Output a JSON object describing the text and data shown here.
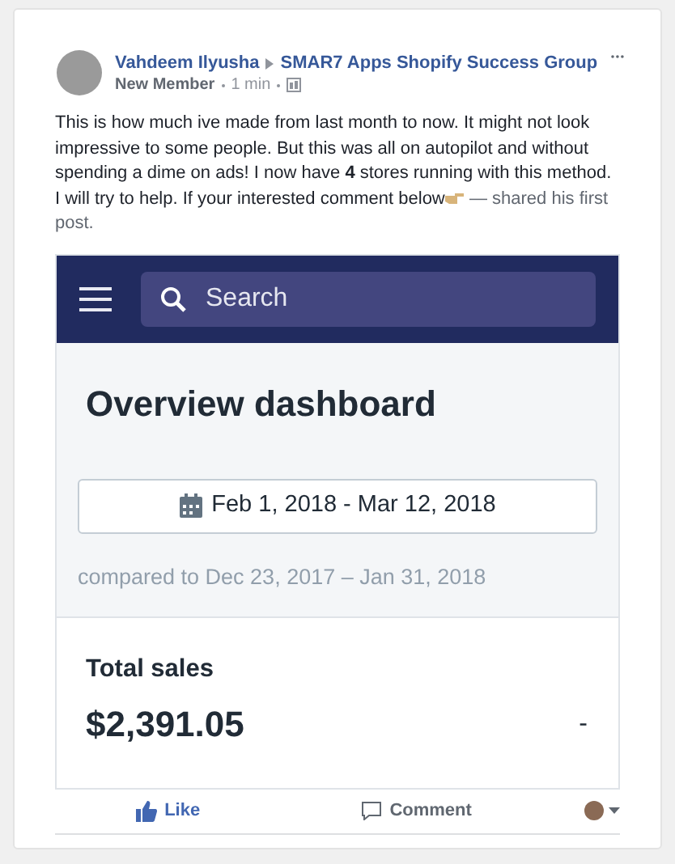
{
  "post": {
    "author": "Vahdeem Ilyusha",
    "group": "SMAR7 Apps Shopify Success Group",
    "role": "New Member",
    "time": "1 min",
    "body": "This is how much ive made from last month to now. It might not look impressive to some people. But this was all on autopilot and without spending a dime on ads! I now have **4** stores running with this method. I will try to help. If your interested comment below",
    "shared_note": "— shared his first post."
  },
  "screenshot": {
    "search": {
      "placeholder": "Search"
    },
    "title": "Overview dashboard",
    "date_range": "Feb 1, 2018 - Mar 12, 2018",
    "comparison": "compared to Dec 23, 2017 – Jan 31, 2018",
    "metric": {
      "label": "Total sales",
      "value": "$2,391.05",
      "change": "-"
    }
  },
  "actions": [
    {
      "label": "Like",
      "kind": "like",
      "selected": true
    },
    {
      "label": "Comment",
      "kind": "comment",
      "selected": false
    }
  ]
}
